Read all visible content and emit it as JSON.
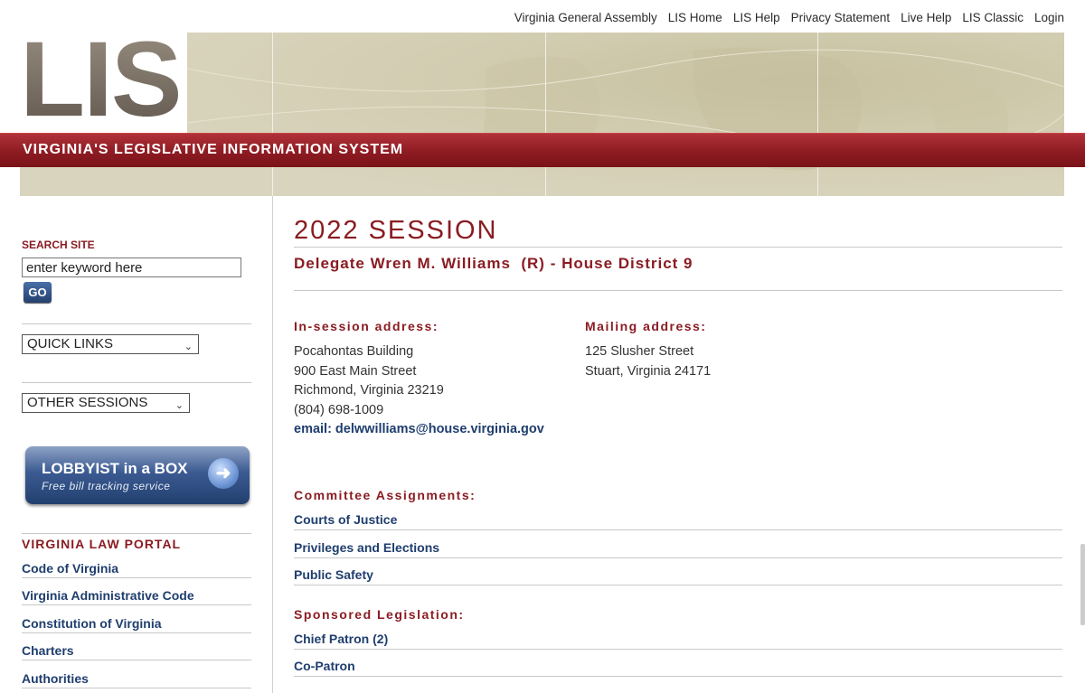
{
  "topnav": [
    "Virginia General Assembly",
    "LIS Home",
    "LIS Help",
    "Privacy Statement",
    "Live Help",
    "LIS Classic",
    "Login"
  ],
  "banner": {
    "logo": "LIS",
    "tagline": "VIRGINIA'S LEGISLATIVE INFORMATION SYSTEM"
  },
  "sidebar": {
    "search_label": "SEARCH SITE",
    "search_placeholder": "enter keyword here",
    "go_label": "GO",
    "quick_links": "QUICK LINKS",
    "other_sessions": "OTHER SESSIONS",
    "lobbyist_title": "LOBBYIST in a BOX",
    "lobbyist_sub": "Free bill tracking service",
    "portal_title": "VIRGINIA LAW PORTAL",
    "portal_links": [
      "Code of Virginia",
      "Virginia Administrative Code",
      "Constitution of Virginia",
      "Charters",
      "Authorities"
    ]
  },
  "main": {
    "session": "2022 SESSION",
    "delegate": "Delegate Wren M. Williams  (R) - House District 9",
    "insession_head": "In-session address:",
    "insession_lines": [
      "Pocahontas Building",
      "900 East Main Street",
      "Richmond, Virginia 23219",
      "(804) 698-1009"
    ],
    "email": "email: delwwilliams@house.virginia.gov",
    "mailing_head": "Mailing address:",
    "mailing_lines": [
      "125 Slusher Street",
      "Stuart, Virginia 24171"
    ],
    "committee_head": "Committee Assignments:",
    "committees": [
      "Courts of Justice",
      "Privileges and Elections",
      "Public Safety"
    ],
    "sponsored_head": "Sponsored Legislation:",
    "sponsored": [
      "Chief Patron (2)",
      "Co-Patron"
    ]
  }
}
